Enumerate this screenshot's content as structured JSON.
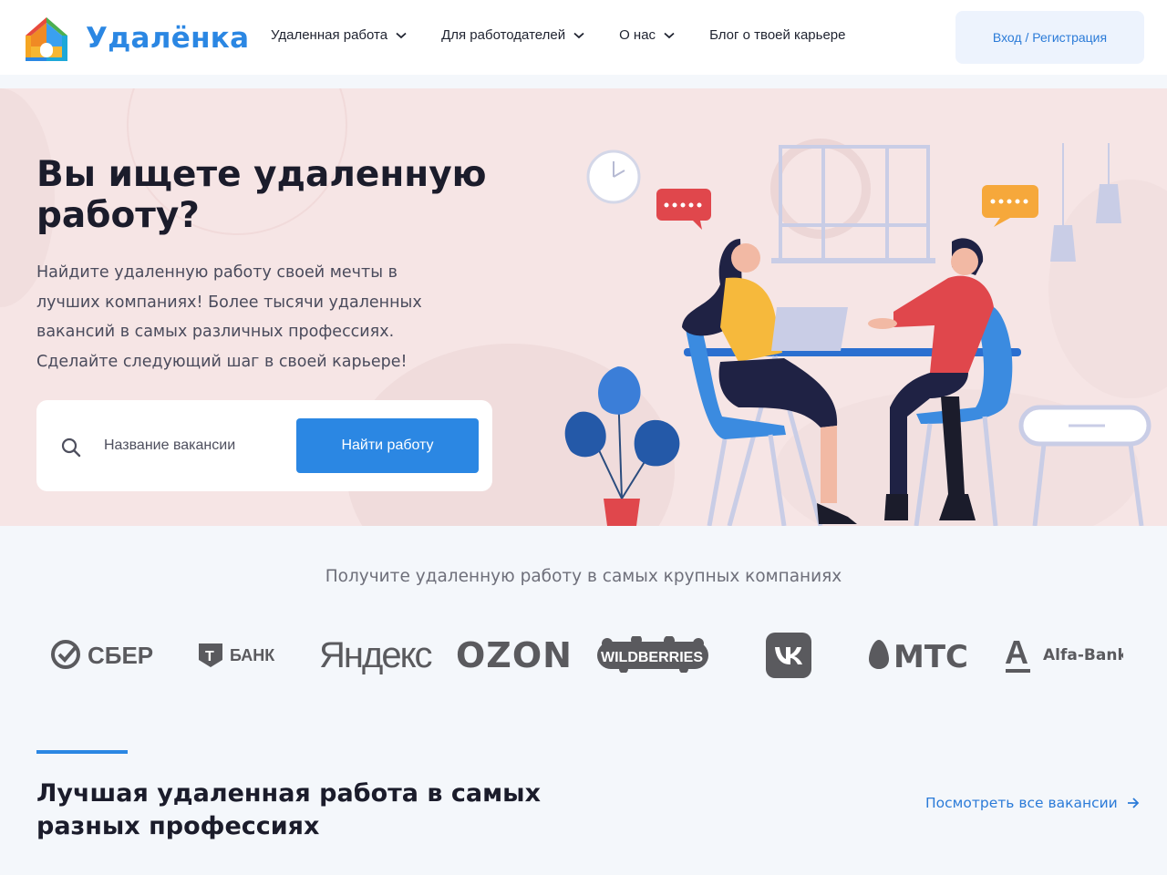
{
  "brand": {
    "name": "Удалёнка"
  },
  "nav": {
    "items": [
      {
        "label": "Удаленная работа",
        "dropdown": true
      },
      {
        "label": "Для работодателей",
        "dropdown": true
      },
      {
        "label": "О нас",
        "dropdown": true
      },
      {
        "label": "Блог о твоей карьере",
        "dropdown": false
      }
    ],
    "login_label": "Вход / Регистрация"
  },
  "hero": {
    "title": "Вы ищете удаленную работу?",
    "subtitle": "Найдите удаленную работу своей мечты в лучших компаниях! Более тысячи удаленных вакансий в самых различных профессиях. Сделайте следующий шаг в своей карьере!",
    "search": {
      "placeholder": "Название вакансии",
      "value": "",
      "button_label": "Найти работу"
    }
  },
  "partners": {
    "title": "Получите удаленную работу в самых крупных компаниях",
    "logos": [
      {
        "name": "sber",
        "text": "СБЕР"
      },
      {
        "name": "tbank",
        "text": "БАНК",
        "mark": "Т"
      },
      {
        "name": "yandex",
        "text": "Яндекс"
      },
      {
        "name": "ozon",
        "text": "OZON"
      },
      {
        "name": "wildberries",
        "text": "WILDBERRIES"
      },
      {
        "name": "vk",
        "text": "VK"
      },
      {
        "name": "mts",
        "text": "МТС"
      },
      {
        "name": "alfa-bank",
        "text": "Alfa-Bank",
        "mark": "А"
      }
    ]
  },
  "section": {
    "title": "Лучшая удаленная работа в самых разных профессиях",
    "link_label": "Посмотреть все вакансии"
  },
  "colors": {
    "accent": "#2b87e3",
    "hero_bg": "#f6e5e5",
    "page_bg": "#f4f7fb",
    "logo_gray": "#5a5a5e"
  },
  "icons": [
    "logo-house-icon",
    "chevron-down-icon",
    "search-icon",
    "arrow-right-icon"
  ]
}
